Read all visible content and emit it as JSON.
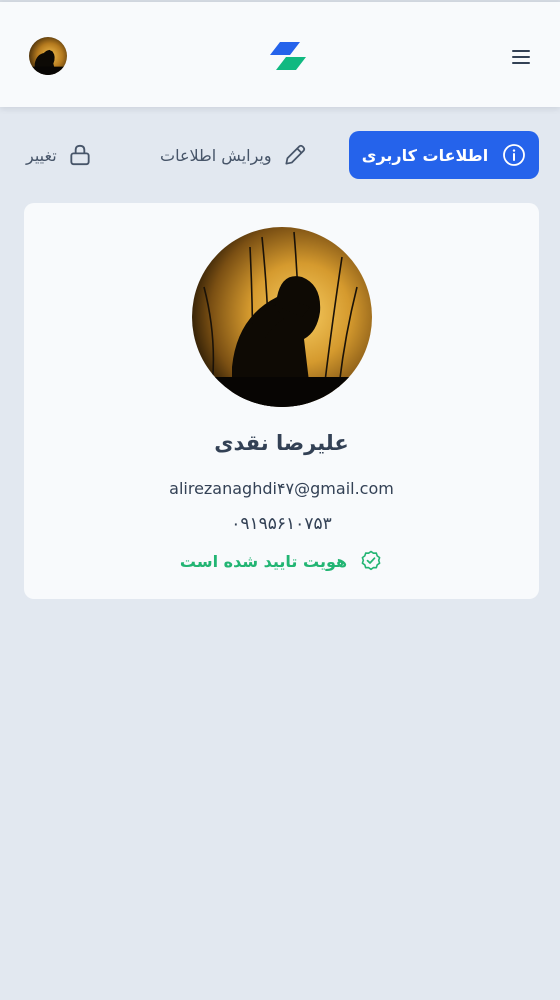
{
  "header": {
    "menu_icon": "hamburger-menu-icon",
    "logo_icon": "brand-logo-icon",
    "avatar_icon": "user-avatar-icon"
  },
  "tabs": [
    {
      "label": "اطلاعات کاربری",
      "icon": "info-circle-icon",
      "active": true
    },
    {
      "label": "ویرایش اطلاعات",
      "icon": "pencil-icon",
      "active": false
    },
    {
      "label": "تغییر",
      "icon": "lock-icon",
      "active": false
    }
  ],
  "profile": {
    "name": "علیرضا نقدی",
    "email": "alirezanaghdi۴۷@gmail.com",
    "phone": "۰۹۱۹۵۶۱۰۷۵۳",
    "verified_label": "هویت تایید شده است",
    "verified_icon": "verified-badge-icon"
  },
  "colors": {
    "primary": "#2563eb",
    "success": "#22b573",
    "background": "#e2e8f0",
    "surface": "#f8fafc",
    "text": "#334155",
    "logo_blue": "#2563eb",
    "logo_green": "#10b981"
  }
}
